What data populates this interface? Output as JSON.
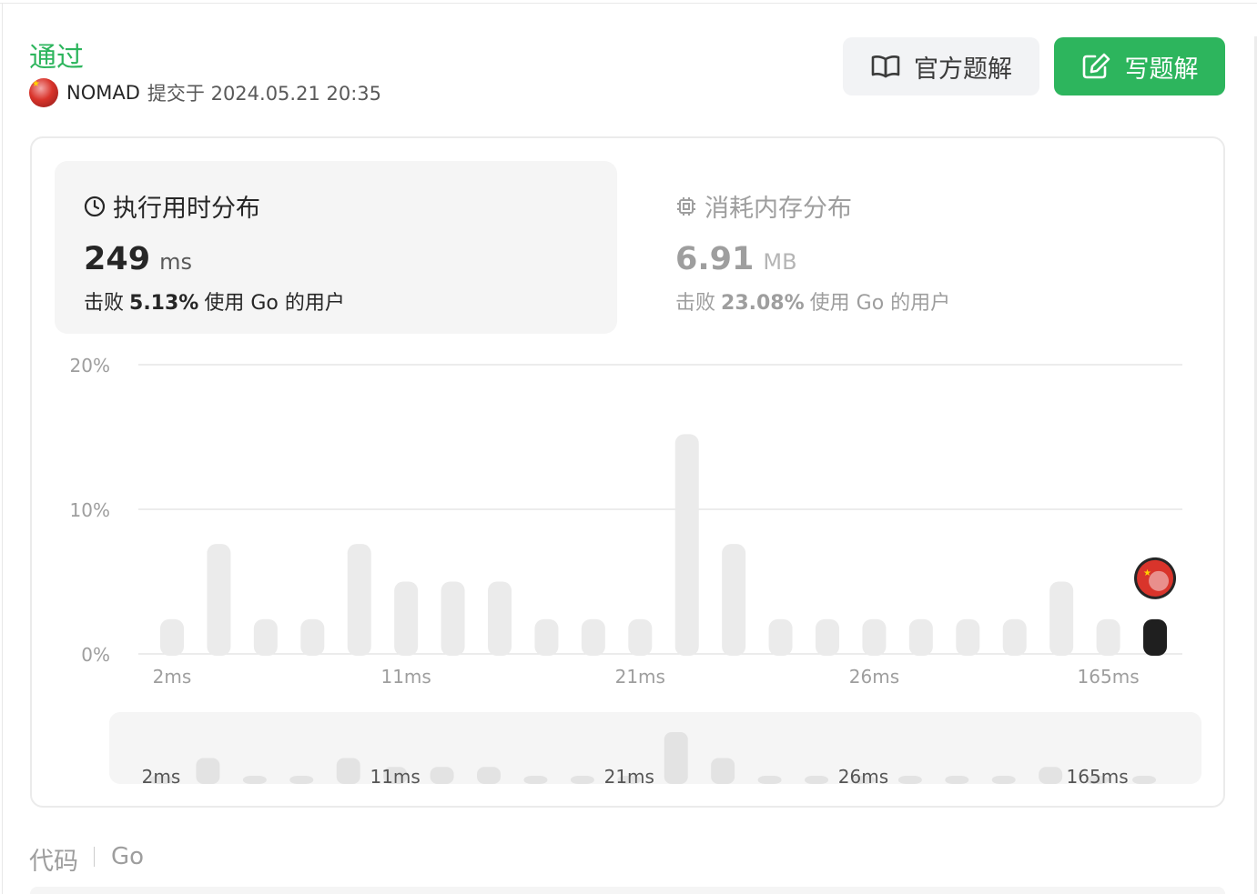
{
  "status": "通过",
  "submission": {
    "user": "NOMAD",
    "text": "提交于 2024.05.21 20:35"
  },
  "buttons": {
    "official_solution": "官方题解",
    "write_solution": "写题解"
  },
  "runtime": {
    "title": "执行用时分布",
    "value": "249",
    "unit": "ms",
    "beats_prefix": "击败",
    "beats_pct": "5.13%",
    "beats_suffix": "使用 Go 的用户"
  },
  "memory": {
    "title": "消耗内存分布",
    "value": "6.91",
    "unit": "MB",
    "beats_prefix": "击败",
    "beats_pct": "23.08%",
    "beats_suffix": "使用 Go 的用户"
  },
  "code": {
    "title": "代码",
    "language": "Go"
  },
  "colors": {
    "accent": "#2db55d",
    "bar": "#ebebeb",
    "highlight_bar": "#1f1f1f"
  },
  "chart_data": {
    "type": "bar",
    "ylim": [
      0,
      20
    ],
    "y_ticks": [
      "20%",
      "10%",
      "0%"
    ],
    "x_tick_labels": [
      "2ms",
      "11ms",
      "21ms",
      "26ms",
      "165ms"
    ],
    "values": [
      2.4,
      7.6,
      2.4,
      2.4,
      7.6,
      5.0,
      5.0,
      5.0,
      2.4,
      2.4,
      2.4,
      15.2,
      7.6,
      2.4,
      2.4,
      2.4,
      2.4,
      2.4,
      2.4,
      5.0,
      2.4,
      2.4
    ],
    "highlight_index": 21,
    "grid": true
  }
}
